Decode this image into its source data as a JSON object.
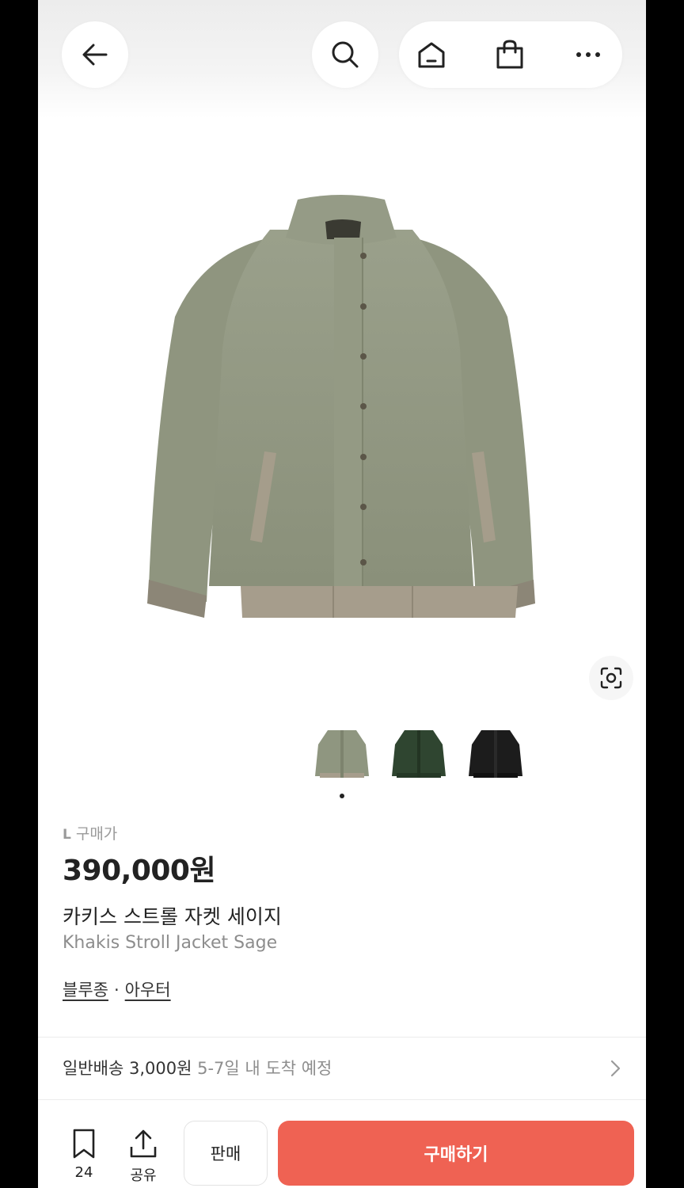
{
  "header": {
    "icons": [
      "back-arrow-icon",
      "search-icon",
      "home-icon",
      "shopping-bag-icon",
      "more-icon"
    ]
  },
  "gallery": {
    "thumbnails": [
      {
        "name": "sage",
        "color": "#8f9680"
      },
      {
        "name": "green",
        "color": "#2f4530"
      },
      {
        "name": "black",
        "color": "#1c1c1c"
      }
    ],
    "active_index": 0
  },
  "product": {
    "size": "L",
    "price_label": "구매가",
    "price": "390,000원",
    "name_ko": "카키스 스트롤 자켓 세이지",
    "name_en": "Khakis Stroll Jacket Sage",
    "categories": [
      "블루종",
      "아우터"
    ],
    "category_separator": "·"
  },
  "shipping": {
    "label": "일반배송 3,000원",
    "eta": "5-7일 내 도착 예정"
  },
  "bottom_bar": {
    "save_count": "24",
    "share_label": "공유",
    "sell_label": "판매",
    "buy_label": "구매하기",
    "buy_color": "#ef6253"
  }
}
